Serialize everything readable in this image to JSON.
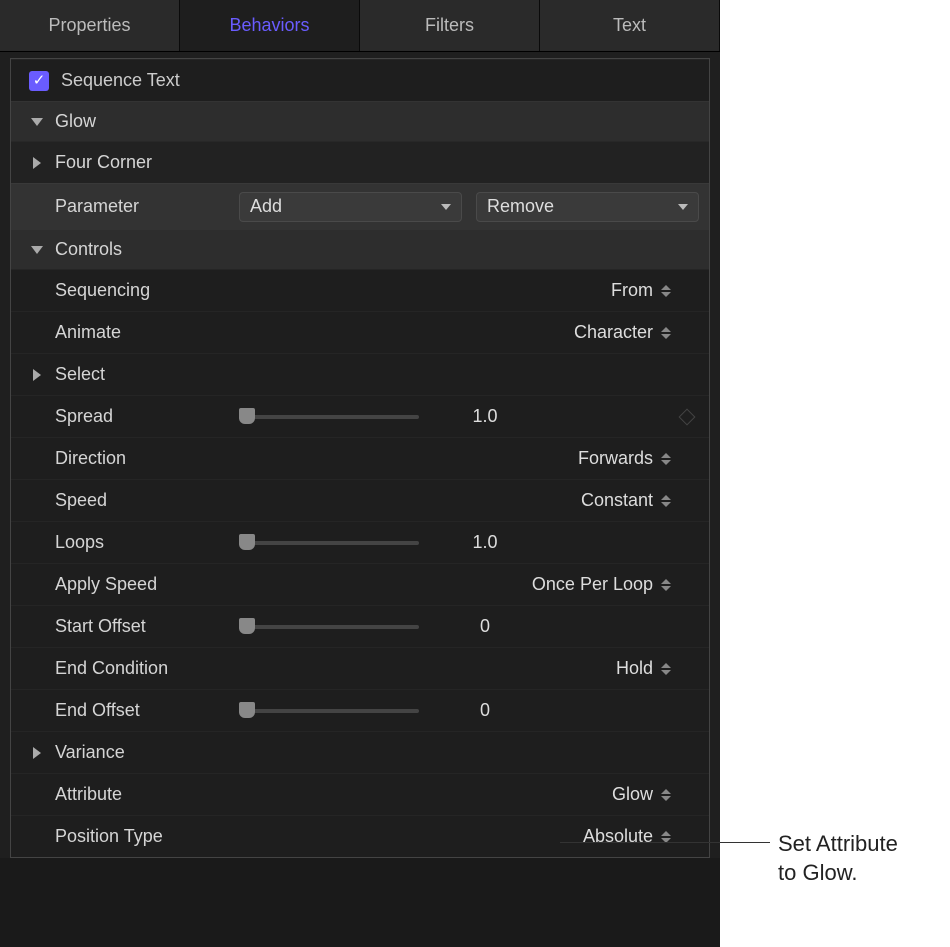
{
  "tabs": {
    "properties": "Properties",
    "behaviors": "Behaviors",
    "filters": "Filters",
    "text": "Text"
  },
  "header": {
    "sequence_text": "Sequence Text"
  },
  "sections": {
    "glow": "Glow",
    "four_corner": "Four Corner",
    "controls": "Controls",
    "select": "Select",
    "variance": "Variance"
  },
  "parameter": {
    "label": "Parameter",
    "add": "Add",
    "remove": "Remove"
  },
  "controls": {
    "sequencing": {
      "label": "Sequencing",
      "value": "From"
    },
    "animate": {
      "label": "Animate",
      "value": "Character"
    },
    "spread": {
      "label": "Spread",
      "value": "1.0"
    },
    "direction": {
      "label": "Direction",
      "value": "Forwards"
    },
    "speed": {
      "label": "Speed",
      "value": "Constant"
    },
    "loops": {
      "label": "Loops",
      "value": "1.0"
    },
    "apply_speed": {
      "label": "Apply Speed",
      "value": "Once Per Loop"
    },
    "start_offset": {
      "label": "Start Offset",
      "value": "0"
    },
    "end_condition": {
      "label": "End Condition",
      "value": "Hold"
    },
    "end_offset": {
      "label": "End Offset",
      "value": "0"
    },
    "attribute": {
      "label": "Attribute",
      "value": "Glow"
    },
    "position_type": {
      "label": "Position Type",
      "value": "Absolute"
    }
  },
  "callout": {
    "line1": "Set Attribute",
    "line2": "to Glow."
  }
}
